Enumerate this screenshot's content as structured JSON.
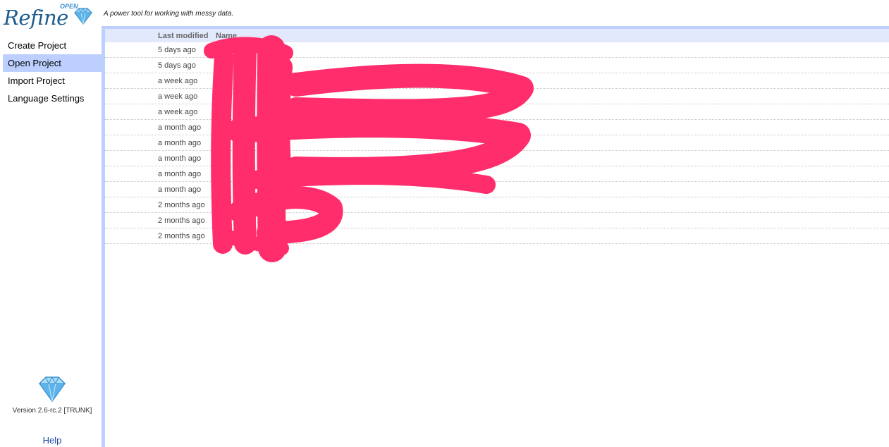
{
  "header": {
    "logo_word": "Refine",
    "logo_prefix": "OPEN",
    "tagline": "A power tool for working with messy data."
  },
  "nav": {
    "items": [
      {
        "label": "Create Project",
        "selected": false
      },
      {
        "label": "Open Project",
        "selected": true
      },
      {
        "label": "Import Project",
        "selected": false
      },
      {
        "label": "Language Settings",
        "selected": false
      }
    ],
    "version": "Version 2.6-rc.2 [TRUNK]",
    "help": "Help"
  },
  "projects": {
    "columns": {
      "modified": "Last modified",
      "name": "Name"
    },
    "rows": [
      {
        "modified": "5 days ago",
        "name": ""
      },
      {
        "modified": "5 days ago",
        "name": ""
      },
      {
        "modified": "a week ago",
        "name": ""
      },
      {
        "modified": "a week ago",
        "name": ""
      },
      {
        "modified": "a week ago",
        "name": ""
      },
      {
        "modified": "a month ago",
        "name": ""
      },
      {
        "modified": "a month ago",
        "name": ""
      },
      {
        "modified": "a month ago",
        "name": ""
      },
      {
        "modified": "a month ago",
        "name": ""
      },
      {
        "modified": "a month ago",
        "name": ""
      },
      {
        "modified": "2 months ago",
        "name": ""
      },
      {
        "modified": "2 months ago",
        "name": ""
      },
      {
        "modified": "2 months ago",
        "name": ""
      }
    ]
  },
  "colors": {
    "accent": "#bccffe",
    "header_row": "#e3e9fd",
    "logo": "#1d5c8f",
    "link": "#1f47a3",
    "redaction": "#ff2d6b"
  }
}
